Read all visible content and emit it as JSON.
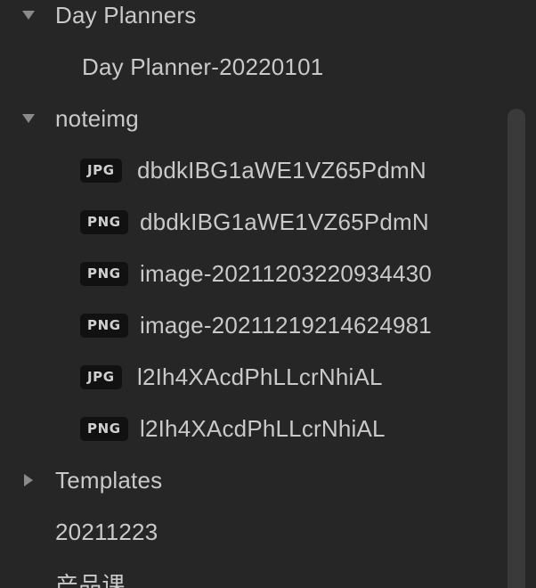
{
  "explorer": {
    "folders": {
      "day_planners": {
        "label": "Day Planners",
        "collapsed": false
      },
      "noteimg": {
        "label": "noteimg",
        "collapsed": false
      },
      "templates": {
        "label": "Templates",
        "collapsed": true
      }
    },
    "files": {
      "day_planner_file": "Day Planner-20220101",
      "file_20211223": "20211223",
      "file_product_course": "产品课"
    },
    "attachments": [
      {
        "type": "JPG",
        "name": "dbdkIBG1aWE1VZ65PdmN"
      },
      {
        "type": "PNG",
        "name": "dbdkIBG1aWE1VZ65PdmN"
      },
      {
        "type": "PNG",
        "name": "image-20211203220934430"
      },
      {
        "type": "PNG",
        "name": "image-20211219214624981"
      },
      {
        "type": "JPG",
        "name": "l2Ih4XAcdPhLLcrNhiAL"
      },
      {
        "type": "PNG",
        "name": "l2Ih4XAcdPhLLcrNhiAL"
      }
    ]
  },
  "icons": {
    "expanded": "chevron-down-icon",
    "collapsed": "chevron-right-icon"
  },
  "colors": {
    "background": "#262626",
    "text": "#c9c9c9",
    "badge_bg": "#111111",
    "chevron": "#8a8a8a",
    "scrollbar": "#3a3a3a"
  }
}
